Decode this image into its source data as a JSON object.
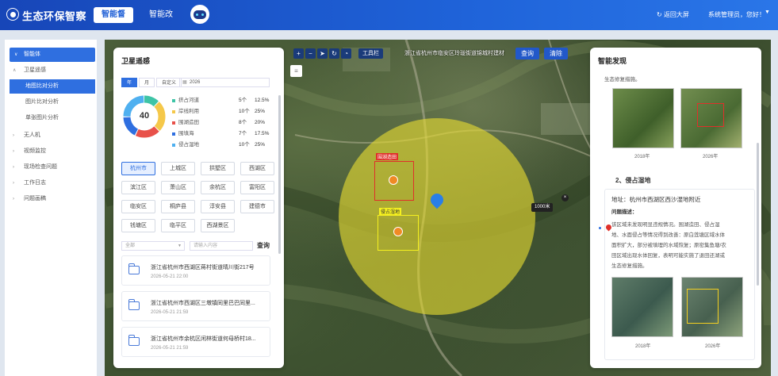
{
  "header": {
    "app_title": "生态环保智察",
    "nav_tabs": [
      "智能督",
      "智能改"
    ],
    "back_label": "返回大屏",
    "user_label": "系统管理员，您好！"
  },
  "sidebar": {
    "items": [
      {
        "label": "智能体"
      },
      {
        "label": "卫星遥感"
      },
      {
        "label": "地图比对分析"
      },
      {
        "label": "图片比对分析"
      },
      {
        "label": "单张图片分析"
      },
      {
        "label": "无人机"
      },
      {
        "label": "视频监控"
      },
      {
        "label": "现场检查问题"
      },
      {
        "label": "工作日志"
      },
      {
        "label": "问题画稿"
      }
    ]
  },
  "map_toolbar": {
    "toolbox_label": "工具栏",
    "address": "浙江省杭州市临安区玲珑街道锦城村建材",
    "query_label": "查询",
    "clear_label": "清除",
    "radius_label": "1000米"
  },
  "map_overlays": {
    "label_red": "围湖造田",
    "label_yellow": "侵占湿地"
  },
  "satellite": {
    "title": "卫星遥感",
    "range_tabs": [
      "年",
      "月",
      "自定义"
    ],
    "year": "2026",
    "total": "40",
    "legend": [
      {
        "name": "挤占河道",
        "count": "5个",
        "pct": "12.5%",
        "color": "#3ec4a6"
      },
      {
        "name": "岸线利用",
        "count": "10个",
        "pct": "25%",
        "color": "#f5c84a"
      },
      {
        "name": "围湖造田",
        "count": "8个",
        "pct": "20%",
        "color": "#e8514a"
      },
      {
        "name": "围填海",
        "count": "7个",
        "pct": "17.5%",
        "color": "#2f6fe0"
      },
      {
        "name": "侵占湿地",
        "count": "10个",
        "pct": "25%",
        "color": "#4fb0f0"
      }
    ],
    "regions": [
      "杭州市",
      "上城区",
      "拱墅区",
      "西湖区",
      "滨江区",
      "萧山区",
      "余杭区",
      "富阳区",
      "临安区",
      "桐庐县",
      "淳安县",
      "建德市",
      "钱塘区",
      "临平区",
      "西湖景区"
    ],
    "filter_placeholder": "全部",
    "search_placeholder": "请输入内容",
    "search_label": "查询",
    "records": [
      {
        "title": "浙江省杭州市西湖区蒋村街道晴川街217号",
        "time": "2026-05-21 22:00"
      },
      {
        "title": "浙江省杭州市西湖区三墩镇同里巴巴同里...",
        "time": "2026-05-21 21:59"
      },
      {
        "title": "浙江省杭州市余杭区闲林街道何母桥村18...",
        "time": "2026-05-21 21:59"
      }
    ]
  },
  "findings": {
    "title": "智能发现",
    "top_text": "生态修复措施。",
    "img_years": [
      "2018年",
      "2026年"
    ],
    "item_heading": "2、侵占湿地",
    "address": "地址：杭州市西湖区西沙湿地附近",
    "desc_title": "问题描述：",
    "desc_lines": [
      "该区域未发现明显违规情况。围湖造田、侵占湿",
      "地、水面侵占等情况得到改善：原白莲塘区域水体",
      "面积扩大，部分被填埋的水域恢复；原密集鱼塘/农",
      "田区域出现水体回复，表明可能实施了退田还湖或",
      "生态修复措施。"
    ]
  }
}
